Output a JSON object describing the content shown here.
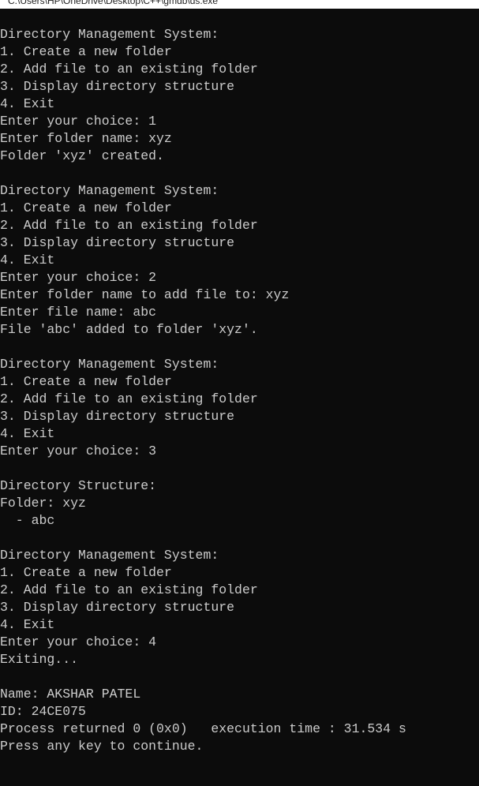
{
  "window": {
    "title": "C:\\Users\\HP\\OneDrive\\Desktop\\C++\\gmdb\\ds.exe"
  },
  "colors": {
    "background": "#0c0c0c",
    "text": "#cccccc",
    "titlebar": "#ffffff"
  },
  "console": {
    "lines": [
      "Directory Management System:",
      "1. Create a new folder",
      "2. Add file to an existing folder",
      "3. Display directory structure",
      "4. Exit",
      "Enter your choice: 1",
      "Enter folder name: xyz",
      "Folder 'xyz' created.",
      "",
      "Directory Management System:",
      "1. Create a new folder",
      "2. Add file to an existing folder",
      "3. Display directory structure",
      "4. Exit",
      "Enter your choice: 2",
      "Enter folder name to add file to: xyz",
      "Enter file name: abc",
      "File 'abc' added to folder 'xyz'.",
      "",
      "Directory Management System:",
      "1. Create a new folder",
      "2. Add file to an existing folder",
      "3. Display directory structure",
      "4. Exit",
      "Enter your choice: 3",
      "",
      "Directory Structure:",
      "Folder: xyz",
      "  - abc",
      "",
      "Directory Management System:",
      "1. Create a new folder",
      "2. Add file to an existing folder",
      "3. Display directory structure",
      "4. Exit",
      "Enter your choice: 4",
      "Exiting...",
      "",
      "Name: AKSHAR PATEL",
      "ID: 24CE075",
      "Process returned 0 (0x0)   execution time : 31.534 s",
      "Press any key to continue."
    ]
  }
}
